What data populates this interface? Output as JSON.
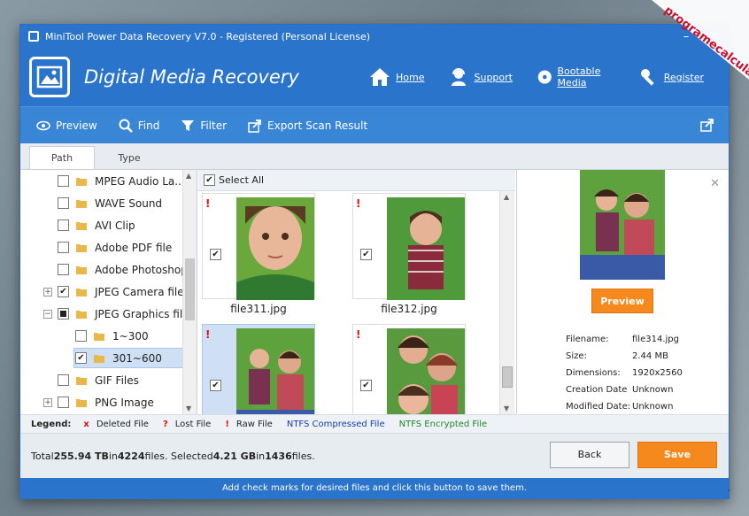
{
  "window": {
    "title": "MiniTool Power Data Recovery V7.0 - Registered (Personal License)"
  },
  "header": {
    "module_title": "Digital Media Recovery",
    "nav": [
      {
        "label": "Home",
        "icon": "home-icon"
      },
      {
        "label": "Support",
        "icon": "support-icon"
      },
      {
        "label": "Bootable Media",
        "icon": "disc-icon"
      },
      {
        "label": "Register",
        "icon": "key-icon"
      }
    ]
  },
  "toolbar": {
    "preview": "Preview",
    "find": "Find",
    "filter": "Filter",
    "export": "Export Scan Result"
  },
  "tabs": [
    "Path",
    "Type"
  ],
  "tree": [
    {
      "label": "MPEG Audio La...",
      "checked": false
    },
    {
      "label": "WAVE Sound",
      "checked": false
    },
    {
      "label": "AVI Clip",
      "checked": false
    },
    {
      "label": "Adobe PDF file",
      "checked": false
    },
    {
      "label": "Adobe Photoshop",
      "checked": false
    },
    {
      "label": "JPEG Camera file",
      "checked": true
    },
    {
      "label": "JPEG Graphics file",
      "checked": "partial"
    },
    {
      "label": "1~300",
      "checked": false
    },
    {
      "label": "301~600",
      "checked": true
    },
    {
      "label": "GIF Files",
      "checked": false
    },
    {
      "label": "PNG Image",
      "checked": false
    }
  ],
  "files": {
    "select_all": "Select All",
    "items": [
      {
        "name": "file311.jpg",
        "mark": "!"
      },
      {
        "name": "file312.jpg",
        "mark": "!"
      },
      {
        "name": "",
        "mark": "!"
      },
      {
        "name": "",
        "mark": "!"
      }
    ]
  },
  "preview": {
    "button": "Preview",
    "info": [
      {
        "k": "Filename:",
        "v": "file314.jpg"
      },
      {
        "k": "Size:",
        "v": "2.44 MB"
      },
      {
        "k": "Dimensions:",
        "v": "1920x2560"
      },
      {
        "k": "Creation Date",
        "v": "Unknown"
      },
      {
        "k": "Modified Date:",
        "v": "Unknown"
      }
    ]
  },
  "legend": {
    "label": "Legend:",
    "items": [
      {
        "sym": "x",
        "label": "Deleted File",
        "color": "#d11"
      },
      {
        "sym": "?",
        "label": "Lost File",
        "color": "#d11"
      },
      {
        "sym": "!",
        "label": "Raw File",
        "color": "#d11"
      },
      {
        "sym": "",
        "label": "NTFS Compressed File",
        "color": "#1a3caa"
      },
      {
        "sym": "",
        "label": "NTFS Encrypted File",
        "color": "#1c8a2a"
      }
    ]
  },
  "summary": {
    "total_prefix": "Total ",
    "total_size": "255.94 TB",
    "in1": " in ",
    "total_files": "4224",
    "files1": " files.  Selected ",
    "sel_size": "4.21 GB",
    "in2": " in ",
    "sel_files": "1436",
    "files2": " files."
  },
  "buttons": {
    "back": "Back",
    "save": "Save"
  },
  "footer": "Add check marks for desired files and click this button to save them.",
  "watermark": "programecalculator.ro",
  "colors": {
    "accent": "#2b74cc",
    "save": "#f5891e"
  }
}
